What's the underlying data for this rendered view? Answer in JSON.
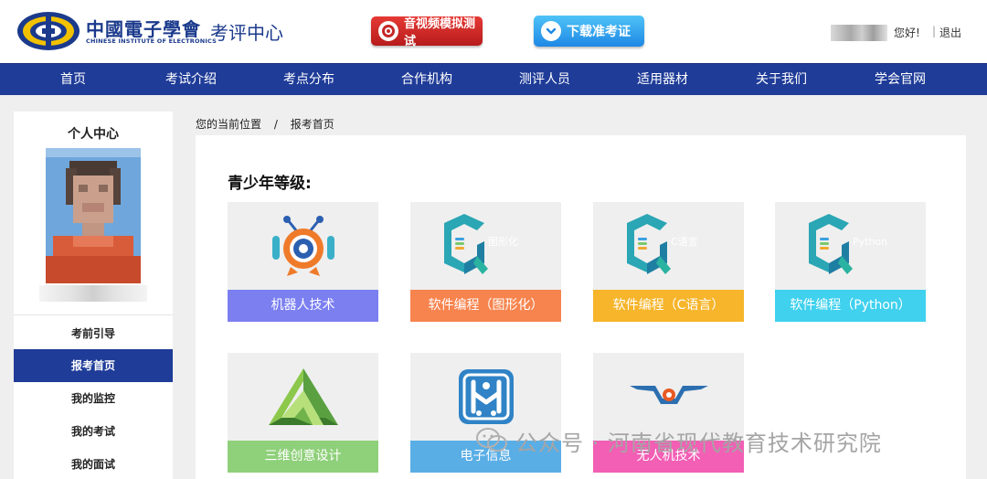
{
  "header": {
    "logo_cn": "中國電子學會",
    "logo_en": "CHINESE INSTITUTE OF ELECTRONICS",
    "logo_sub": "考评中心",
    "btn_av": "音视频模拟测试",
    "btn_download": "下载准考证",
    "greeting": "您好!",
    "logout": "退出"
  },
  "nav": {
    "items": [
      "首页",
      "考试介绍",
      "考点分布",
      "合作机构",
      "测评人员",
      "适用器材",
      "关于我们",
      "学会官网"
    ]
  },
  "sidebar": {
    "title": "个人中心",
    "items": [
      "考前引导",
      "报考首页",
      "我的监控",
      "我的考试",
      "我的面试"
    ],
    "active_index": 1
  },
  "breadcrumb": {
    "current": "您的当前位置",
    "sep": "/",
    "page": "报考首页"
  },
  "main": {
    "section_title": "青少年等级:",
    "cards": [
      {
        "label": "机器人技术",
        "color": "#7b7ff0",
        "icon": "robot-icon",
        "overlay": ""
      },
      {
        "label": "软件编程（图形化）",
        "color": "#f7844e",
        "icon": "code-logo-icon",
        "overlay": "图形化"
      },
      {
        "label": "软件编程（C语言）",
        "color": "#f6b52b",
        "icon": "code-logo-icon",
        "overlay": "C语言"
      },
      {
        "label": "软件编程（Python）",
        "color": "#3fd1ee",
        "icon": "code-logo-icon",
        "overlay": "Python"
      },
      {
        "label": "三维创意设计",
        "color": "#8fd07a",
        "icon": "triangle-3d-icon",
        "overlay": ""
      },
      {
        "label": "电子信息",
        "color": "#5aaee6",
        "icon": "circuit-icon",
        "overlay": ""
      },
      {
        "label": "无人机技术",
        "color": "#f25fb5",
        "icon": "drone-icon",
        "overlay": ""
      }
    ]
  },
  "watermark": {
    "text": "公众号 · 河南省现代教育技术研究院"
  },
  "colors": {
    "nav_blue": "#1f3c98",
    "page_bg": "#efefef"
  }
}
